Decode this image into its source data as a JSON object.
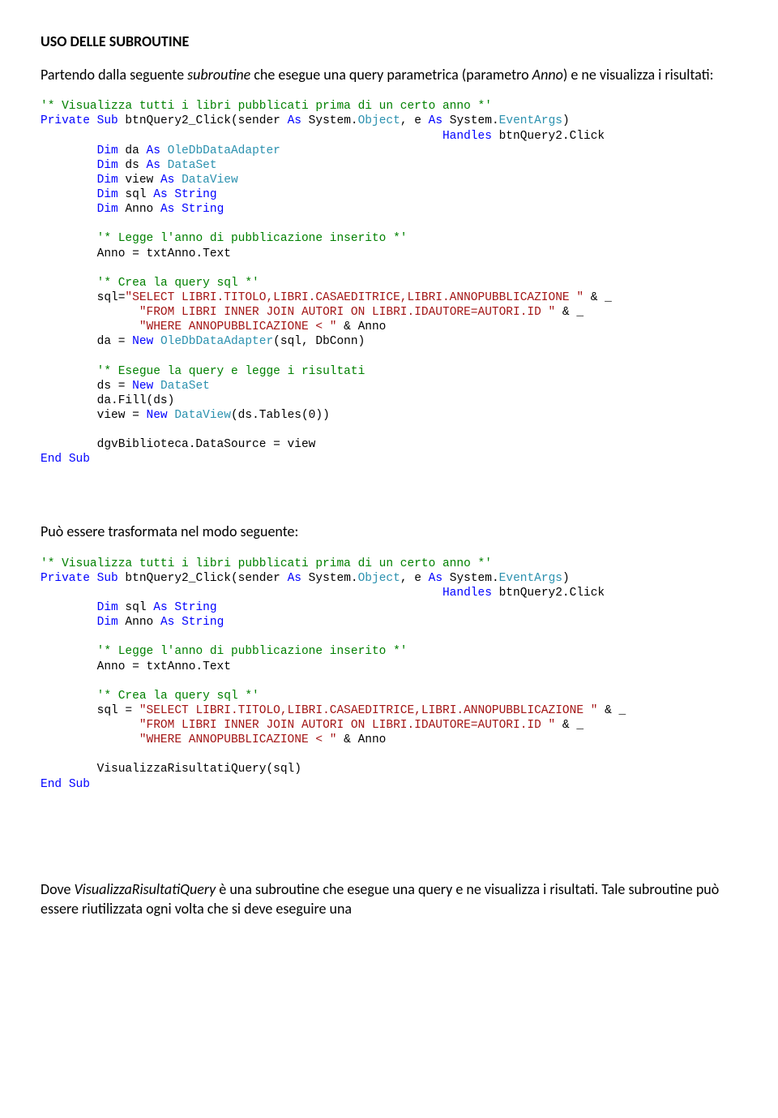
{
  "heading": "USO DELLE SUBROUTINE",
  "intro_text": "Partendo dalla seguente subroutine che esegue una query parametrica (parametro Anno) e ne visualizza i risultati:",
  "intro_italic_words": {
    "subroutine": "subroutine",
    "anno": "Anno"
  },
  "code1": {
    "c1": "'* Visualizza tutti i libri pubblicati prima di un certo anno *'",
    "c2a": "Private",
    "c2b": "Sub",
    "c2c": " btnQuery2_Click(sender ",
    "c2d": "As",
    "c2e": " System.",
    "c2f": "Object",
    "c2g": ", e ",
    "c2h": "As",
    "c2i": " System.",
    "c2j": "EventArgs",
    "c2k": ")",
    "c3a": "Handles",
    "c3b": " btnQuery2.Click",
    "c4a": "Dim",
    "c4b": " da ",
    "c4c": "As",
    "c4d": "OleDbDataAdapter",
    "c5a": "Dim",
    "c5b": " ds ",
    "c5c": "As",
    "c5d": "DataSet",
    "c6a": "Dim",
    "c6b": " view ",
    "c6c": "As",
    "c6d": "DataView",
    "c7a": "Dim",
    "c7b": " sql ",
    "c7c": "As",
    "c7d": "String",
    "c8a": "Dim",
    "c8b": " Anno ",
    "c8c": "As",
    "c8d": "String",
    "c9": "'* Legge l'anno di pubblicazione inserito *'",
    "c10": "        Anno = txtAnno.Text",
    "c11": "'* Crea la query sql *'",
    "c12a": "        sql=",
    "c12b": "\"SELECT LIBRI.TITOLO,LIBRI.CASAEDITRICE,LIBRI.ANNOPUBBLICAZIONE \"",
    "c12c": " & _",
    "c13a": "              ",
    "c13b": "\"FROM LIBRI INNER JOIN AUTORI ON LIBRI.IDAUTORE=AUTORI.ID \"",
    "c13c": " & _",
    "c14a": "              ",
    "c14b": "\"WHERE ANNOPUBBLICAZIONE < \"",
    "c14c": " & Anno",
    "c15a": "        da = ",
    "c15b": "New",
    "c15c": "OleDbDataAdapter",
    "c15d": "(sql, DbConn)",
    "c16": "'* Esegue la query e legge i risultati",
    "c17a": "        ds = ",
    "c17b": "New",
    "c17c": "DataSet",
    "c18": "        da.Fill(ds)",
    "c19a": "        view = ",
    "c19b": "New",
    "c19c": "DataView",
    "c19d": "(ds.Tables(0))",
    "c20": "        dgvBiblioteca.DataSource = view",
    "c21a": "End",
    "c21b": "Sub"
  },
  "mid_text": "Può essere trasformata nel modo seguente:",
  "code2": {
    "c1": "'* Visualizza tutti i libri pubblicati prima di un certo anno *'",
    "c2a": "Private",
    "c2b": "Sub",
    "c2c": " btnQuery2_Click(sender ",
    "c2d": "As",
    "c2e": " System.",
    "c2f": "Object",
    "c2g": ", e ",
    "c2h": "As",
    "c2i": " System.",
    "c2j": "EventArgs",
    "c2k": ")",
    "c3a": "Handles",
    "c3b": " btnQuery2.Click",
    "c4a": "Dim",
    "c4b": " sql ",
    "c4c": "As",
    "c4d": "String",
    "c5a": "Dim",
    "c5b": " Anno ",
    "c5c": "As",
    "c5d": "String",
    "c6": "'* Legge l'anno di pubblicazione inserito *'",
    "c7": "        Anno = txtAnno.Text",
    "c8": "'* Crea la query sql *'",
    "c9a": "        sql = ",
    "c9b": "\"SELECT LIBRI.TITOLO,LIBRI.CASAEDITRICE,LIBRI.ANNOPUBBLICAZIONE \"",
    "c9c": " & _",
    "c10a": "              ",
    "c10b": "\"FROM LIBRI INNER JOIN AUTORI ON LIBRI.IDAUTORE=AUTORI.ID \"",
    "c10c": " & _",
    "c11a": "              ",
    "c11b": "\"WHERE ANNOPUBBLICAZIONE < \"",
    "c11c": " & Anno",
    "c12": "        VisualizzaRisultatiQuery(sql)",
    "c13a": "End",
    "c13b": "Sub"
  },
  "outro_prefix": "Dove ",
  "outro_italic": "VisualizzaRisultatiQuery",
  "outro_rest": " è una subroutine che esegue una query e ne visualizza i risultati. Tale subroutine può essere riutilizzata ogni volta che si deve eseguire una"
}
